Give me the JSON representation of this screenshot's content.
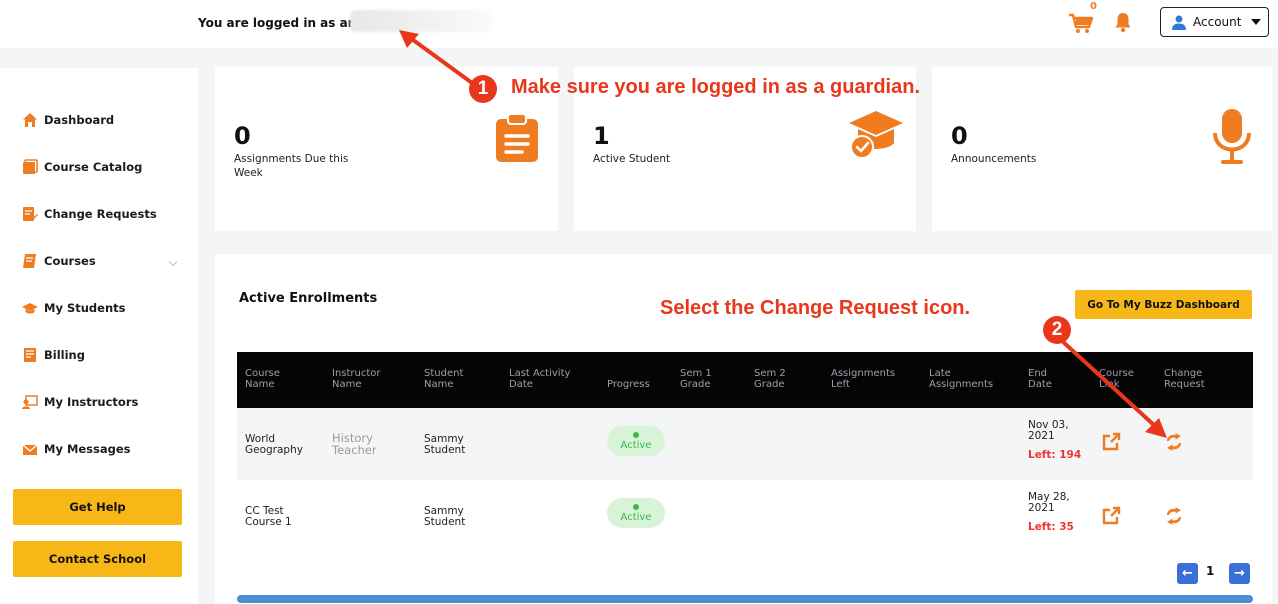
{
  "header": {
    "login_text": "You are logged in as an",
    "cart_count": "0",
    "account_label": "Account"
  },
  "sidebar": {
    "items": [
      {
        "label": "Dashboard",
        "icon": "home-icon"
      },
      {
        "label": "Course Catalog",
        "icon": "catalog-icon"
      },
      {
        "label": "Change Requests",
        "icon": "change-requests-icon"
      },
      {
        "label": "Courses",
        "icon": "courses-icon"
      },
      {
        "label": "My Students",
        "icon": "graduation-cap-icon"
      },
      {
        "label": "Billing",
        "icon": "billing-icon"
      },
      {
        "label": "My Instructors",
        "icon": "instructor-icon"
      },
      {
        "label": "My Messages",
        "icon": "messages-icon"
      }
    ],
    "get_help": "Get Help",
    "contact_school": "Contact School"
  },
  "cards": [
    {
      "number": "0",
      "label": "Assignments Due this Week",
      "icon": "clipboard-icon"
    },
    {
      "number": "1",
      "label": "Active Student",
      "icon": "graduation-cap-icon"
    },
    {
      "number": "0",
      "label": "Announcements",
      "icon": "microphone-icon"
    }
  ],
  "annotations": {
    "step1_number": "1",
    "step1_text": "Make sure you are logged in as a guardian.",
    "step2_number": "2",
    "step2_text": "Select the Change Request icon."
  },
  "enrollments": {
    "title": "Active Enrollments",
    "buzz_button": "Go To My Buzz Dashboard",
    "columns": [
      [
        "Course",
        "Name"
      ],
      [
        "Instructor",
        "Name"
      ],
      [
        "Student",
        "Name"
      ],
      [
        "Last Activity",
        "Date"
      ],
      [
        "Progress",
        ""
      ],
      [
        "Sem 1",
        "Grade"
      ],
      [
        "Sem 2",
        "Grade"
      ],
      [
        "Assignments",
        "Left"
      ],
      [
        "Late",
        "Assignments"
      ],
      [
        "End",
        "Date"
      ],
      [
        "Course",
        "Link"
      ],
      [
        "Change",
        "Request"
      ]
    ],
    "rows": [
      {
        "course": [
          "World",
          "Geography"
        ],
        "instructor": [
          "History",
          "Teacher"
        ],
        "student": [
          "Sammy",
          "Student"
        ],
        "progress": "Active",
        "end_date": [
          "Nov 03,",
          "2021"
        ],
        "left": "Left: 194"
      },
      {
        "course": [
          "CC Test",
          "Course 1"
        ],
        "instructor": [
          "",
          ""
        ],
        "student": [
          "Sammy",
          "Student"
        ],
        "progress": "Active",
        "end_date": [
          "May 28,",
          "2021"
        ],
        "left": "Left: 35"
      }
    ],
    "page": "1"
  },
  "colors": {
    "accent_orange": "#f07c22",
    "button_yellow": "#f7b817",
    "annotation_red": "#e8371b",
    "pager_blue": "#3a6fd8"
  }
}
